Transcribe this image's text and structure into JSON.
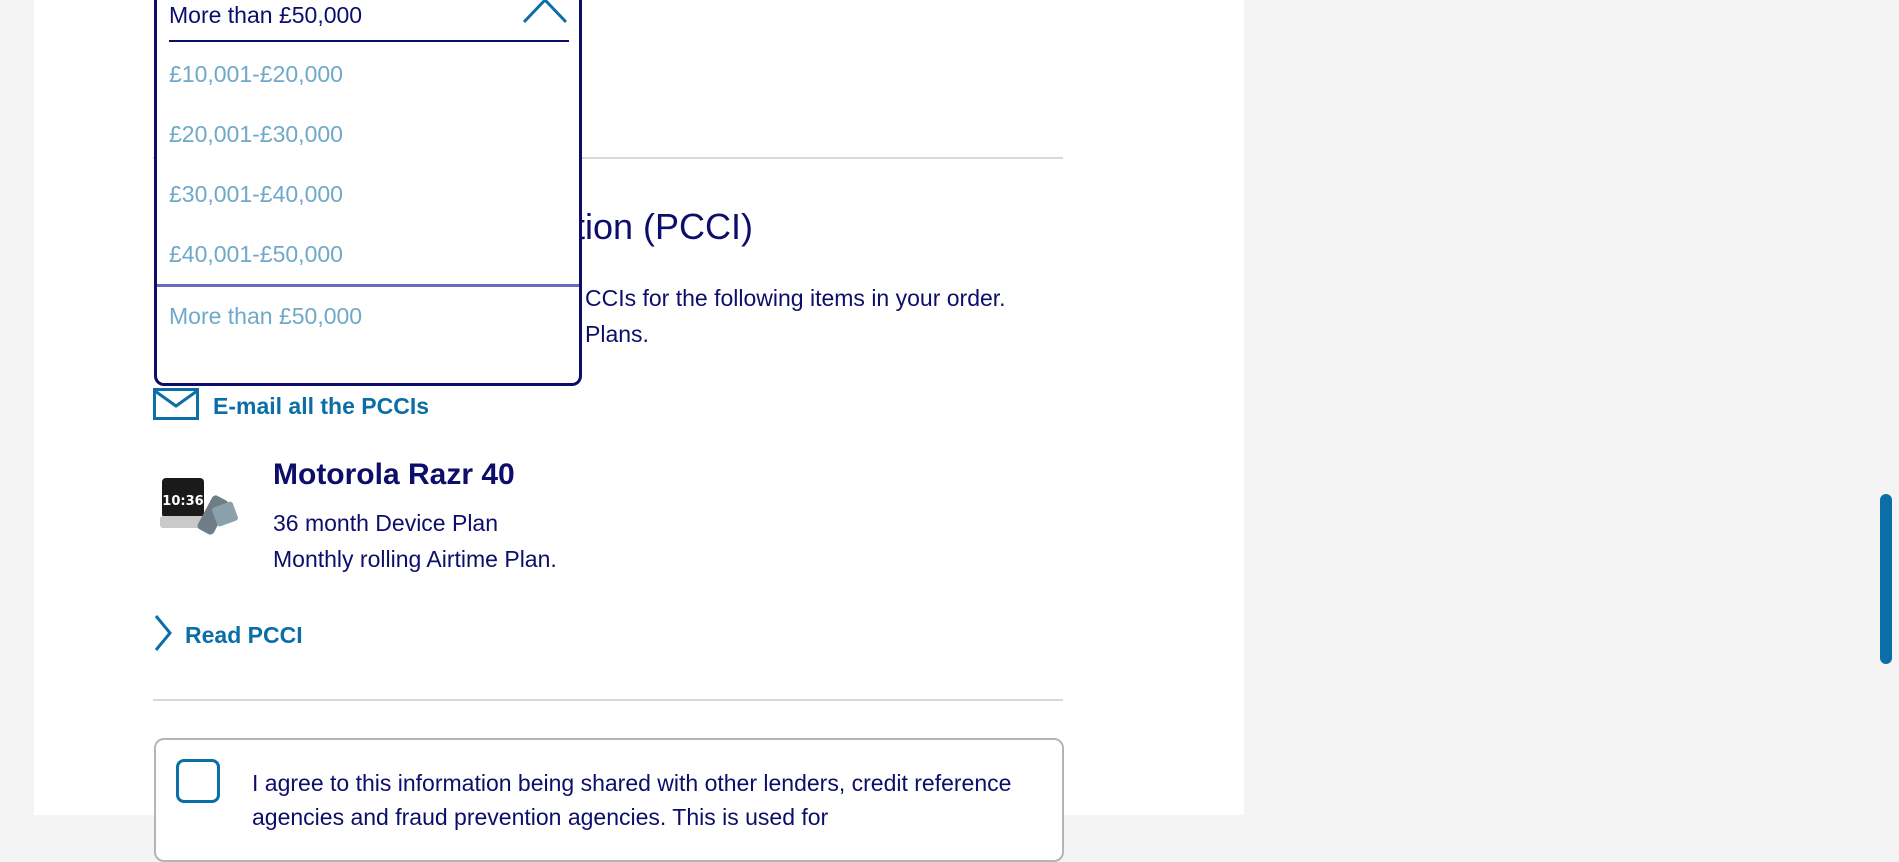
{
  "income_dropdown": {
    "selected": "More than £50,000",
    "options": [
      "£10,001-£20,000",
      "£20,001-£30,000",
      "£30,001-£40,000",
      "£40,001-£50,000",
      "More than £50,000"
    ]
  },
  "pcci": {
    "heading_visible": "tion (PCCI)",
    "intro_line1": "CCIs for the following items in your order.",
    "intro_line2": "Plans.",
    "email_all_label": "E-mail all the PCCIs"
  },
  "product": {
    "name": "Motorola Razr 40",
    "plan_line1": "36 month Device Plan",
    "plan_line2": "Monthly rolling Airtime Plan.",
    "image_time_text": "10:36",
    "read_pcci_label": "Read PCCI"
  },
  "consent": {
    "text": "I agree to this information being shared with other lenders, credit reference agencies and fraud prevention agencies. This is used for"
  },
  "colors": {
    "navy": "#0d0d6b",
    "link_blue": "#0b6ea6",
    "option_muted": "#6fa9c9",
    "divider": "#d9d9d9"
  },
  "icons": [
    "chevron-up-icon",
    "mail-icon",
    "chevron-right-icon"
  ]
}
